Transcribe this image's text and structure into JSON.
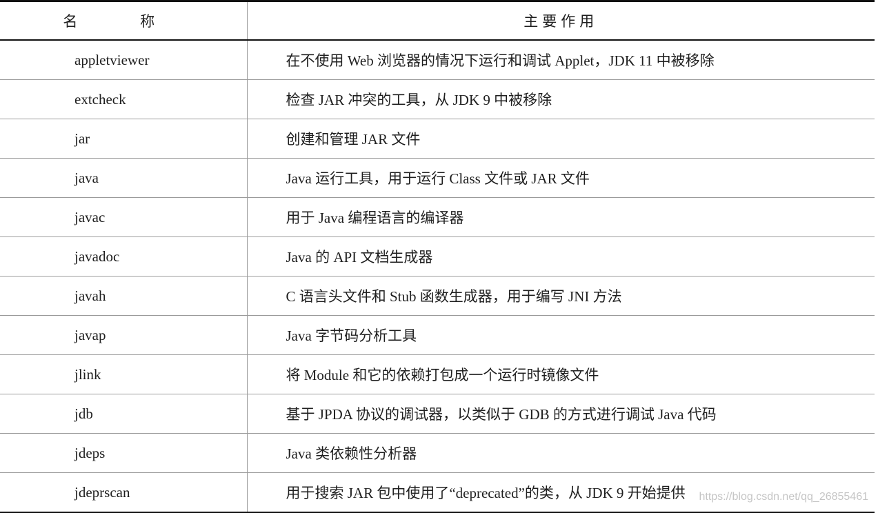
{
  "header": {
    "col_name": "名 称",
    "col_purpose": "主要作用"
  },
  "rows": [
    {
      "tool": "appletviewer",
      "desc": "在不使用 Web 浏览器的情况下运行和调试 Applet，JDK 11 中被移除"
    },
    {
      "tool": "extcheck",
      "desc": "检查 JAR 冲突的工具，从 JDK 9 中被移除"
    },
    {
      "tool": "jar",
      "desc": "创建和管理 JAR 文件"
    },
    {
      "tool": "java",
      "desc": "Java 运行工具，用于运行 Class 文件或 JAR 文件"
    },
    {
      "tool": "javac",
      "desc": "用于 Java 编程语言的编译器"
    },
    {
      "tool": "javadoc",
      "desc": "Java 的 API 文档生成器"
    },
    {
      "tool": "javah",
      "desc": "C 语言头文件和 Stub 函数生成器，用于编写 JNI 方法"
    },
    {
      "tool": "javap",
      "desc": "Java 字节码分析工具"
    },
    {
      "tool": "jlink",
      "desc": "将 Module 和它的依赖打包成一个运行时镜像文件"
    },
    {
      "tool": "jdb",
      "desc": "基于 JPDA 协议的调试器，以类似于 GDB 的方式进行调试 Java 代码"
    },
    {
      "tool": "jdeps",
      "desc": "Java 类依赖性分析器"
    },
    {
      "tool": "jdeprscan",
      "desc": "用于搜索 JAR 包中使用了“deprecated”的类，从 JDK 9 开始提供"
    }
  ],
  "watermark": "https://blog.csdn.net/qq_26855461"
}
